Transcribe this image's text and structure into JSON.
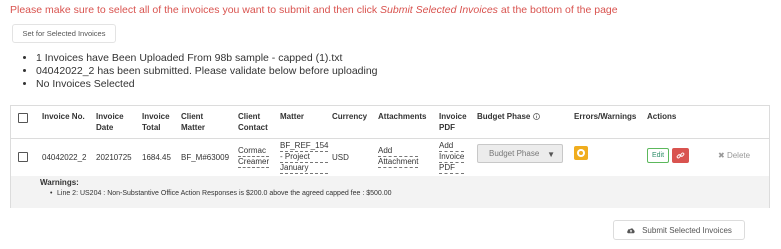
{
  "notice": {
    "text_before": "Please make sure to select all of the invoices you want to submit and then click ",
    "emphasis": "Submit Selected Invoices",
    "text_after": " at the bottom of the page"
  },
  "set_for_selected_label": "Set for Selected Invoices",
  "status_messages": [
    "1 Invoices have Been Uploaded From 98b sample - capped (1).txt",
    "04042022_2 has been submitted. Please validate below before uploading",
    "No Invoices Selected"
  ],
  "table": {
    "headers": {
      "invoice_no": "Invoice No.",
      "invoice_date": [
        "Invoice",
        "Date"
      ],
      "invoice_total": [
        "Invoice",
        "Total"
      ],
      "client_matter": [
        "Client",
        "Matter"
      ],
      "client_contact": [
        "Client",
        "Contact"
      ],
      "matter": "Matter",
      "currency": "Currency",
      "attachments": "Attachments",
      "invoice_pdf": [
        "Invoice",
        "PDF"
      ],
      "budget_phase": "Budget Phase",
      "errors_warnings": "Errors/Warnings",
      "actions": "Actions"
    },
    "row": {
      "invoice_no": "04042022_2",
      "invoice_date": "20210725",
      "invoice_total": "1684.45",
      "client_matter": "BF_M#63009",
      "client_contact": [
        "Cormac",
        "Creamer"
      ],
      "matter": [
        "BF_REF_154",
        "- Project",
        "January"
      ],
      "currency": "USD",
      "attachments": [
        "Add",
        "Attachment"
      ],
      "invoice_pdf": [
        "Add",
        "Invoice",
        "PDF"
      ],
      "budget_phase_value": "Budget Phase",
      "edit_label": "Edit",
      "delete_label": "Delete"
    },
    "warnings": {
      "title": "Warnings:",
      "items": [
        "Line 2: US204 : Non-Substantive Office Action Responses is $200.0 above the agreed capped fee : $500.00"
      ]
    }
  },
  "submit_label": "Submit Selected Invoices",
  "colors": {
    "notice": "#d9534f",
    "warning_badge": "#f0ad1e",
    "edit_border": "#5cb85c",
    "link_button": "#d9534f"
  },
  "icons": [
    "info-icon",
    "warning-icon",
    "link-icon",
    "delete-x-icon",
    "cloud-upload-icon",
    "caret-down-icon"
  ]
}
